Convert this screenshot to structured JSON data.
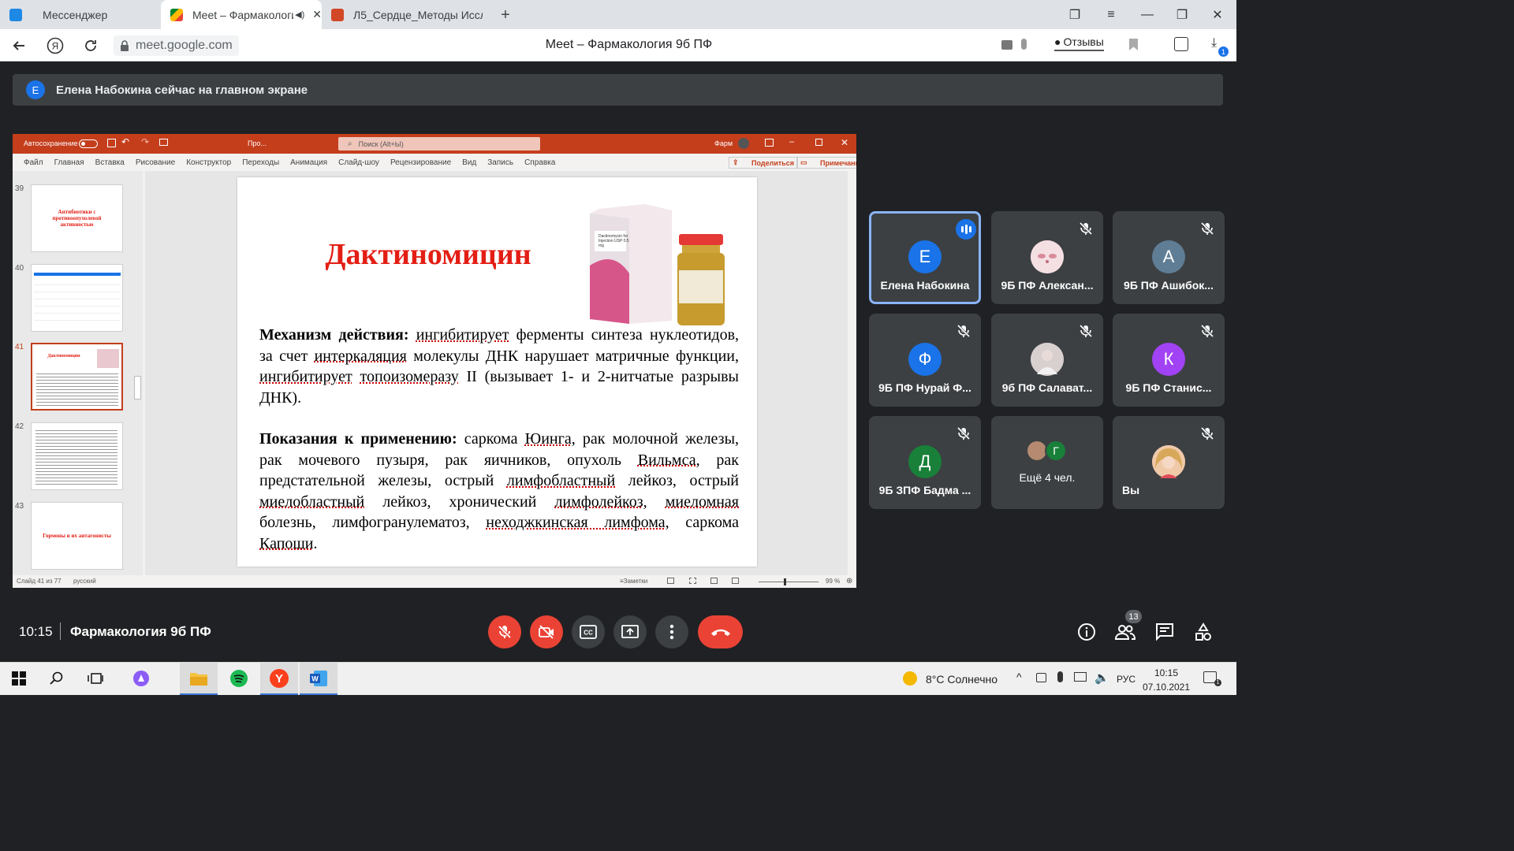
{
  "browser": {
    "tabs": [
      {
        "label": "Мессенджер",
        "icon": "messenger-icon"
      },
      {
        "label": "Meet – Фармакологи",
        "icon": "google-meet-icon",
        "active": true
      },
      {
        "label": "Л5_Сердце_Методы Иссле",
        "icon": "powerpoint-file-icon"
      }
    ],
    "url": "meet.google.com",
    "page_title": "Meet – Фармакология 9б ПФ",
    "feedback_label": "Отзывы",
    "download_count": "1"
  },
  "banner": {
    "avatar_letter": "Е",
    "text": "Елена Набокина сейчас на главном экране"
  },
  "ppt": {
    "autosave": "Автосохранение",
    "doc_short": "Про...",
    "search_placeholder": "Поиск (Alt+Ы)",
    "user_short": "Фарм",
    "menu": [
      "Файл",
      "Главная",
      "Вставка",
      "Рисование",
      "Конструктор",
      "Переходы",
      "Анимация",
      "Слайд-шоу",
      "Рецензирование",
      "Вид",
      "Запись",
      "Справка"
    ],
    "share_label": "Поделиться",
    "notes_label": "Примечания",
    "thumbnails": [
      {
        "num": "39",
        "text": "Антибиотики с противоопухолевой активностью"
      },
      {
        "num": "40",
        "text": ""
      },
      {
        "num": "41",
        "text": "Дактиномицин"
      },
      {
        "num": "42",
        "text": ""
      },
      {
        "num": "43",
        "text": "Гормоны и их антагонисты"
      }
    ],
    "slide": {
      "title": "Дактиномицин",
      "mech_label": "Механизм действия:",
      "mech_parts": [
        "ингибитирует",
        "ферменты синтеза нуклеотидов, за счет",
        "интеркаляция",
        "молекулы ДНК нарушает матричные функции,",
        "ингибитирует",
        "топоизомеразу",
        "II (вызывает 1- и 2-нитчатые разрывы ДНК)."
      ],
      "ind_label": "Показания к применению:",
      "ind_parts": [
        "саркома",
        "Юинга",
        ", рак молочной железы, рак мочевого пузыря, рак яичников, опухоль",
        "Вильмса",
        ", рак предстательной железы, острый",
        "лимфобластный",
        "лейкоз, острый",
        "миелобластный",
        "лейкоз, хронический",
        "лимфолейкоз",
        ",",
        "миеломная",
        "болезнь, лимфогранулематоз,",
        "неходжкинская лимфома",
        ", саркома",
        "Капоши",
        "."
      ],
      "vial_label": "Dactinomycin for Injection USP 0.5 mg"
    },
    "status_slide": "Слайд 41 из 77",
    "status_lang": "русский",
    "status_notes": "Заметки",
    "zoom": "99 %"
  },
  "tiles": [
    {
      "name": "Елена Набокина",
      "letter": "Е",
      "color": "#1a73e8",
      "speaking": true
    },
    {
      "name": "9Б ПФ Алексан...",
      "letter": "",
      "color": "#f4d3d8",
      "muted": true,
      "photo": true
    },
    {
      "name": "9Б ПФ Ашибок...",
      "letter": "А",
      "color": "#5f7d95",
      "muted": true
    },
    {
      "name": "9Б ПФ Нурай Ф...",
      "letter": "Ф",
      "color": "#1a73e8",
      "muted": true
    },
    {
      "name": "9б ПФ Салават...",
      "letter": "",
      "color": "#c9b8b8",
      "muted": true,
      "photo": true
    },
    {
      "name": "9Б ПФ Станис...",
      "letter": "К",
      "color": "#a142f4",
      "muted": true
    },
    {
      "name": "9Б ЗПФ Бадма ...",
      "letter": "Д",
      "color": "#188038",
      "muted": true
    },
    {
      "name": "Ещё 4 чел.",
      "letter": "Г",
      "color": "#188038",
      "others": true
    },
    {
      "name": "Вы",
      "letter": "",
      "color": "#e8a09a",
      "muted": true,
      "photo": true
    }
  ],
  "meeting": {
    "time": "10:15",
    "name": "Фармакология 9б ПФ",
    "participants_count": "13"
  },
  "taskbar": {
    "weather": "8°C  Солнечно",
    "lang": "РУС",
    "time": "10:15",
    "date": "07.10.2021"
  }
}
